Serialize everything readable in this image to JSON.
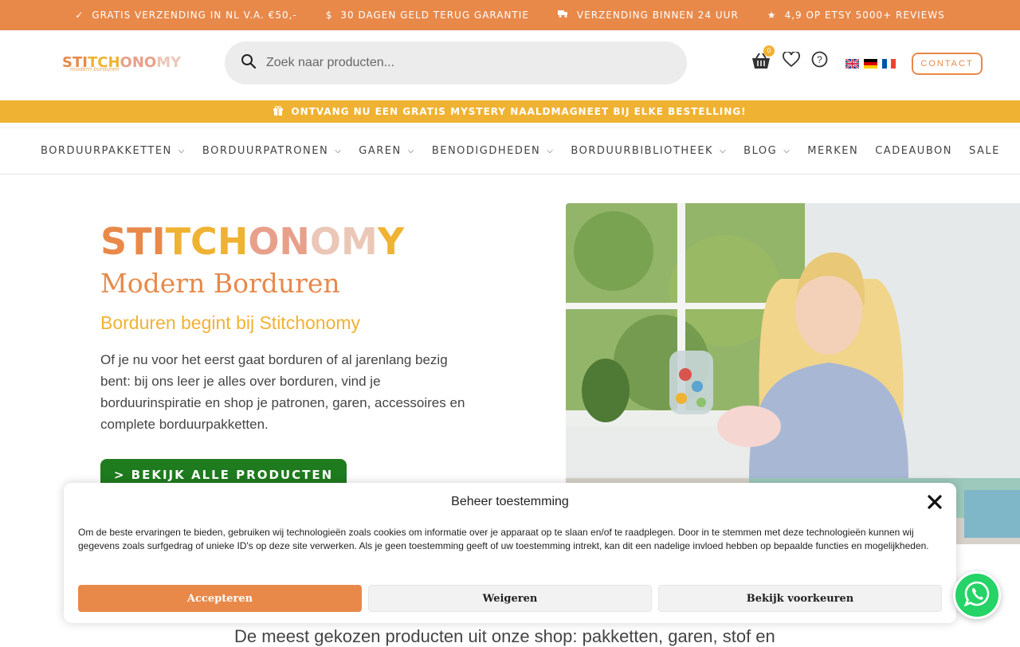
{
  "topbar": {
    "items": [
      {
        "icon": "check-icon",
        "label": "GRATIS VERZENDING IN NL V.A. €50,-"
      },
      {
        "icon": "coin-icon",
        "label": "30 DAGEN GELD TERUG GARANTIE"
      },
      {
        "icon": "truck-icon",
        "label": "VERZENDING BINNEN 24 UUR"
      },
      {
        "icon": "star-icon",
        "label": "4,9 OP ETSY 5000+ REVIEWS"
      }
    ]
  },
  "header": {
    "logo_text": "STITCHONOMY",
    "logo_sub": "modern borduren",
    "search_placeholder": "Zoek naar producten...",
    "cart_count": "0",
    "contact_label": "CONTACT",
    "languages": [
      "English",
      "Deutsch",
      "Français"
    ]
  },
  "announcement": {
    "icon": "gift-icon",
    "text": "ONTVANG NU EEN GRATIS MYSTERY NAALDMAGNEET BIJ ELKE BESTELLING!"
  },
  "nav": {
    "items": [
      {
        "label": "BORDUURPAKKETTEN",
        "dropdown": true
      },
      {
        "label": "BORDUURPATRONEN",
        "dropdown": true
      },
      {
        "label": "GAREN",
        "dropdown": true
      },
      {
        "label": "BENODIGDHEDEN",
        "dropdown": true
      },
      {
        "label": "BORDUURBIBLIOTHEEK",
        "dropdown": true
      },
      {
        "label": "BLOG",
        "dropdown": true
      },
      {
        "label": "MERKEN",
        "dropdown": false
      },
      {
        "label": "CADEAUBON",
        "dropdown": false
      },
      {
        "label": "SALE",
        "dropdown": false
      }
    ]
  },
  "hero": {
    "logo_letters": [
      "S",
      "T",
      "I",
      "T",
      "C",
      "H",
      "O",
      "N",
      "O",
      "M",
      "Y"
    ],
    "logo_colors": [
      "#E8894A",
      "#E8894A",
      "#E8894A",
      "#F0B232",
      "#F0B232",
      "#F0B232",
      "#E8A08A",
      "#E8A08A",
      "#EBC7B8",
      "#EBC7B8",
      "#F0B232"
    ],
    "title": "Modern Borduren",
    "subtitle": "Borduren begint bij Stitchonomy",
    "text": "Of je nu voor het eerst gaat borduren of al jarenlang bezig bent: bij ons leer je alles over borduren, vind je borduurinspiratie en shop je patronen, garen, accessoires en complete borduurpakketten.",
    "button_label": "> BEKIJK ALLE PRODUCTEN"
  },
  "below_text": "De meest gekozen producten uit onze shop: pakketten, garen, stof en",
  "consent": {
    "title": "Beheer toestemming",
    "text": "Om de beste ervaringen te bieden, gebruiken wij technologieën zoals cookies om informatie over je apparaat op te slaan en/of te raadplegen. Door in te stemmen met deze technologieën kunnen wij gegevens zoals surfgedrag of unieke ID's op deze site verwerken. Als je geen toestemming geeft of uw toestemming intrekt, kan dit een nadelige invloed hebben op bepaalde functies en mogelijkheden.",
    "accept_label": "Accepteren",
    "deny_label": "Weigeren",
    "prefs_label": "Bekijk voorkeuren"
  },
  "colors": {
    "orange": "#E8894A",
    "yellow": "#F0B232",
    "green": "#1E7B1E",
    "whatsapp": "#25D366"
  }
}
